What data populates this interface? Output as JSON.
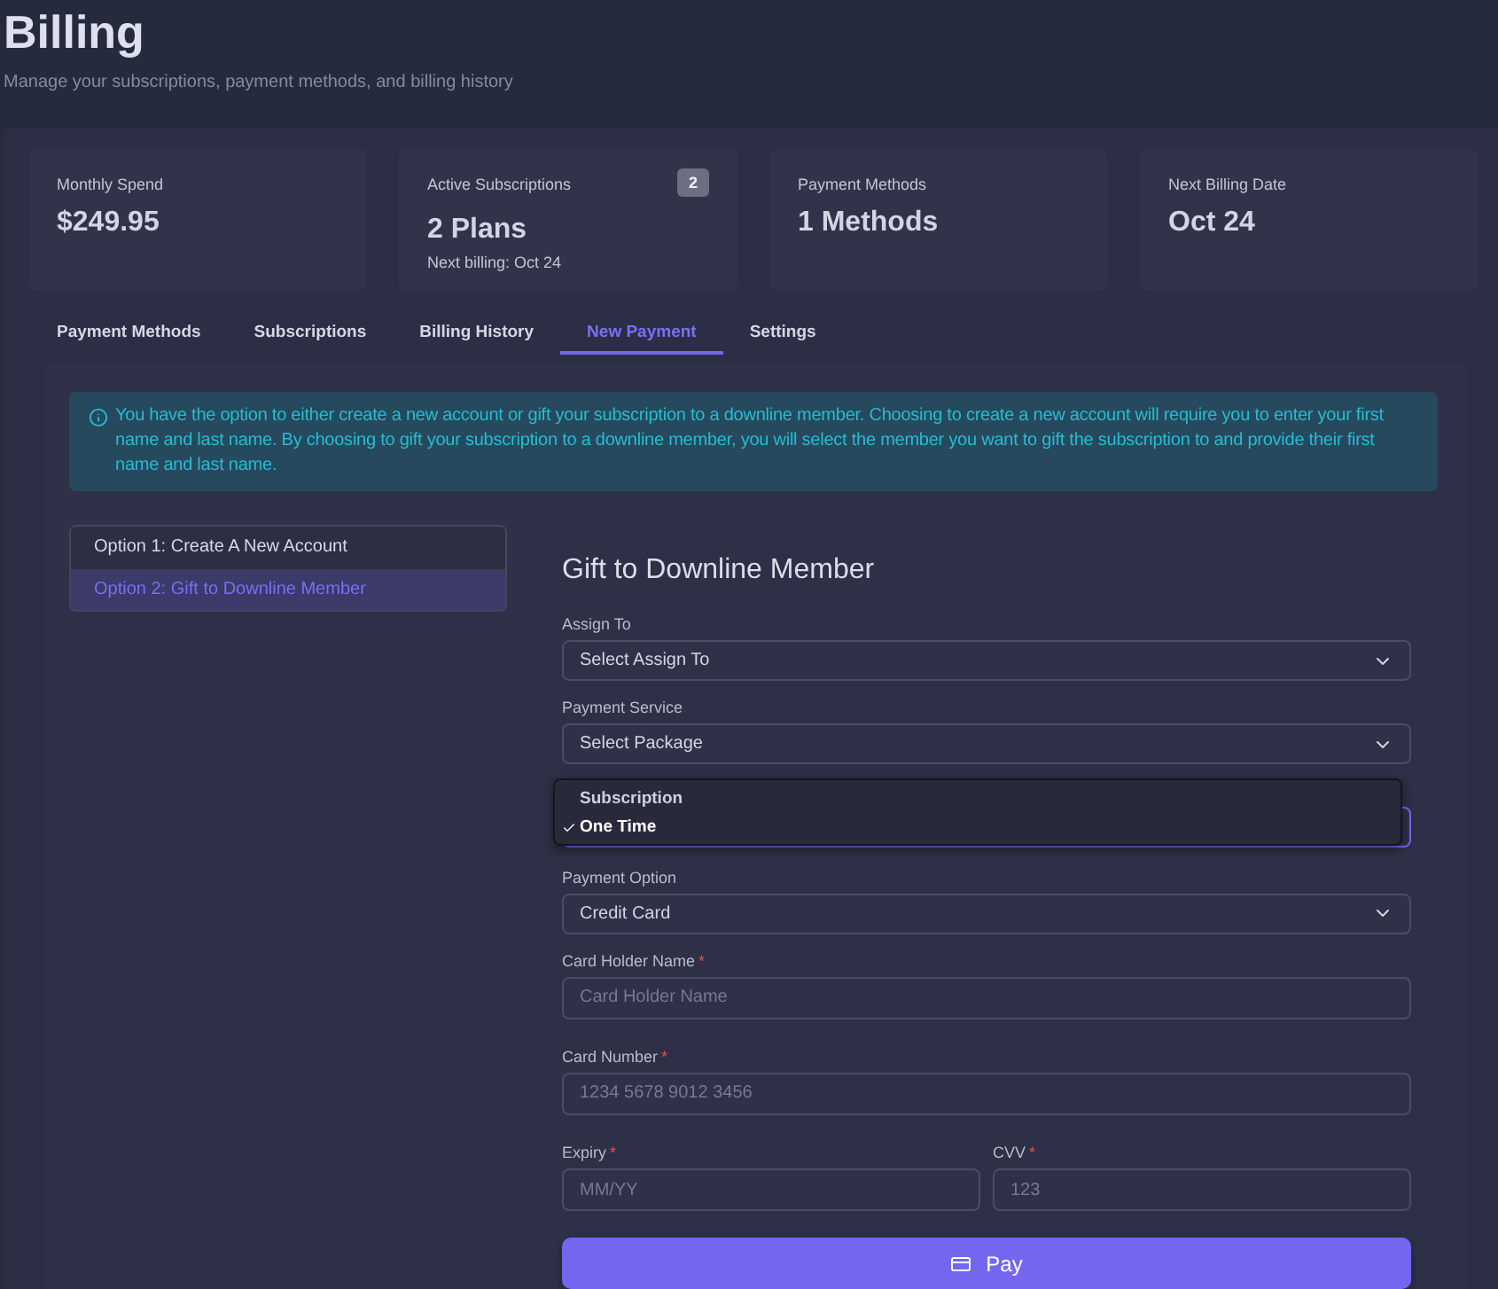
{
  "page": {
    "title": "Billing",
    "subtitle": "Manage your subscriptions, payment methods, and billing history"
  },
  "stats": [
    {
      "label": "Monthly Spend",
      "value": "$249.95"
    },
    {
      "label": "Active Subscriptions",
      "value": "2 Plans",
      "note": "Next billing: Oct 24",
      "badge": "2"
    },
    {
      "label": "Payment Methods",
      "value": "1 Methods"
    },
    {
      "label": "Next Billing Date",
      "value": "Oct 24"
    }
  ],
  "tabs": [
    {
      "label": "Payment Methods",
      "selected": false
    },
    {
      "label": "Subscriptions",
      "selected": false
    },
    {
      "label": "Billing History",
      "selected": false
    },
    {
      "label": "New Payment",
      "selected": true
    },
    {
      "label": "Settings",
      "selected": false
    }
  ],
  "alert": {
    "text": "You have the option to either create a new account or gift your subscription to a downline member. Choosing to create a new account will require you to enter your first name and last name. By choosing to gift your subscription to a downline member, you will select the member you want to gift the subscription to and provide their first name and last name."
  },
  "options": [
    {
      "label": "Option 1: Create A New Account",
      "selected": false
    },
    {
      "label": "Option 2: Gift to Downline Member",
      "selected": true
    }
  ],
  "form": {
    "title": "Gift to Downline Member",
    "fields": [
      {
        "kind": "select",
        "label": "Assign To",
        "value": "Select Assign To"
      },
      {
        "kind": "select",
        "label": "Payment Service",
        "value": "Select Package"
      },
      {
        "kind": "open-select",
        "options": [
          {
            "label": "Subscription",
            "selected": false
          },
          {
            "label": "One Time",
            "selected": true
          }
        ]
      },
      {
        "kind": "select",
        "label": "Payment Option",
        "value": "Credit Card"
      },
      {
        "kind": "input",
        "label": "Card Holder Name",
        "required_mark": "*",
        "placeholder": "Card Holder Name"
      },
      {
        "kind": "input",
        "label": "Card Number",
        "required_mark": "*",
        "placeholder": "1234 5678 9012 3456"
      },
      {
        "kind": "pair",
        "fields": [
          {
            "kind": "input",
            "label": "Expiry",
            "required_mark": "*",
            "placeholder": "MM/YY"
          },
          {
            "kind": "input",
            "label": "CVV",
            "required_mark": "*",
            "placeholder": "123"
          }
        ]
      }
    ],
    "submit": {
      "label": "Pay"
    }
  }
}
